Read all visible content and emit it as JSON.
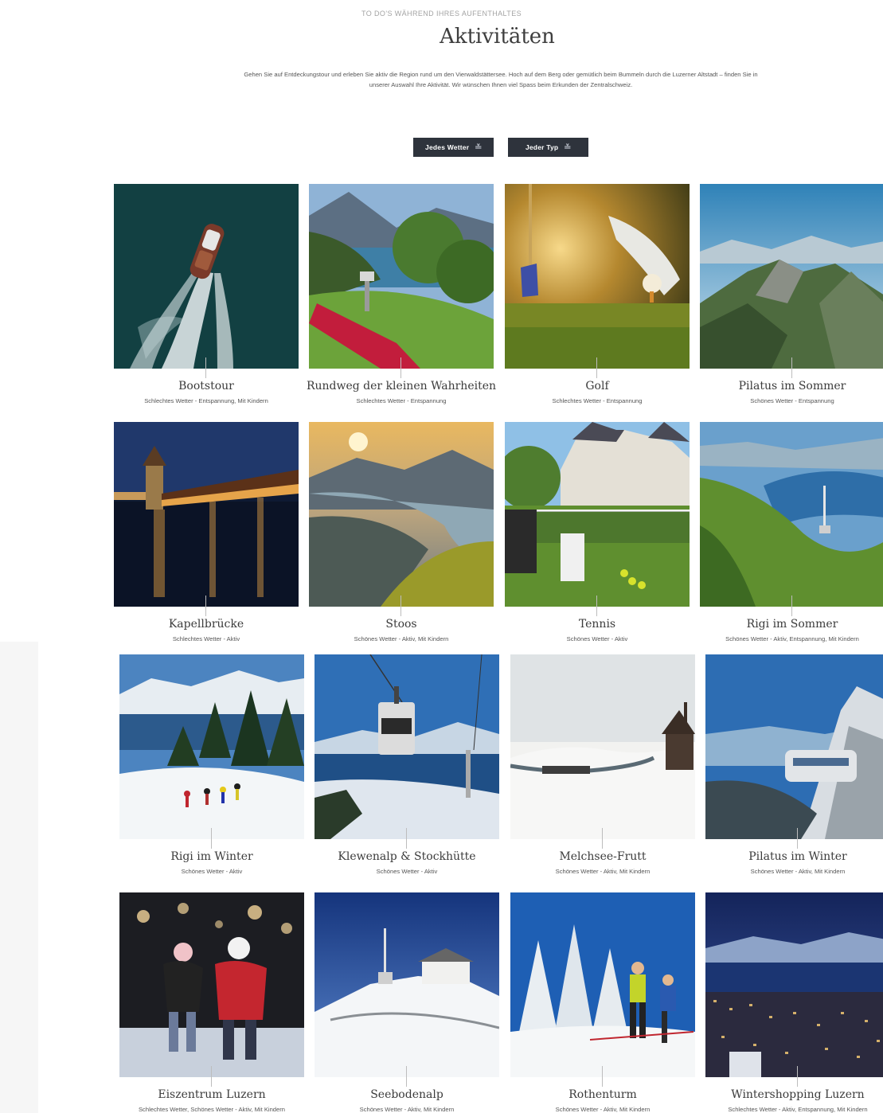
{
  "header": {
    "eyebrow": "TO DO'S WÄHREND IHRES AUFENTHALTES",
    "title": "Aktivitäten",
    "intro": "Gehen Sie auf Entdeckungstour und erleben Sie aktiv die Region rund um den Vierwaldstättersee. Hoch auf dem Berg oder gemütlich beim Bummeln durch die Luzerner Altstadt – finden Sie in unserer Auswahl Ihre Aktivität. Wir wünschen Ihnen viel Spass beim Erkunden der Zentralschweiz."
  },
  "filters": {
    "weather": "Jedes Wetter",
    "type": "Jeder Typ",
    "chevron_icon": "double-chevron-down-icon"
  },
  "activities": [
    {
      "name": "Bootstour",
      "tags": "Schlechtes Wetter - Entspannung, Mit Kindern"
    },
    {
      "name": "Rundweg der kleinen Wahrheiten",
      "tags": "Schlechtes Wetter - Entspannung"
    },
    {
      "name": "Golf",
      "tags": "Schlechtes Wetter - Entspannung"
    },
    {
      "name": "Pilatus im Sommer",
      "tags": "Schönes Wetter - Entspannung"
    },
    {
      "name": "Kapellbrücke",
      "tags": "Schlechtes Wetter - Aktiv"
    },
    {
      "name": "Stoos",
      "tags": "Schönes Wetter - Aktiv, Mit Kindern"
    },
    {
      "name": "Tennis",
      "tags": "Schönes Wetter - Aktiv"
    },
    {
      "name": "Rigi im Sommer",
      "tags": "Schönes Wetter - Aktiv, Entspannung, Mit Kindern"
    },
    {
      "name": "Rigi im Winter",
      "tags": "Schönes Wetter - Aktiv"
    },
    {
      "name": "Klewenalp & Stockhütte",
      "tags": "Schönes Wetter - Aktiv"
    },
    {
      "name": "Melchsee-Frutt",
      "tags": "Schönes Wetter - Aktiv, Mit Kindern"
    },
    {
      "name": "Pilatus im Winter",
      "tags": "Schönes Wetter - Aktiv, Mit Kindern"
    },
    {
      "name": "Eiszentrum Luzern",
      "tags": "Schlechtes Wetter, Schönes Wetter - Aktiv, Mit Kindern"
    },
    {
      "name": "Seebodenalp",
      "tags": "Schönes Wetter - Aktiv, Mit Kindern"
    },
    {
      "name": "Rothenturm",
      "tags": "Schönes Wetter - Aktiv, Mit Kindern"
    },
    {
      "name": "Wintershopping Luzern",
      "tags": "Schlechtes Wetter - Aktiv, Entspannung, Mit Kindern"
    }
  ]
}
